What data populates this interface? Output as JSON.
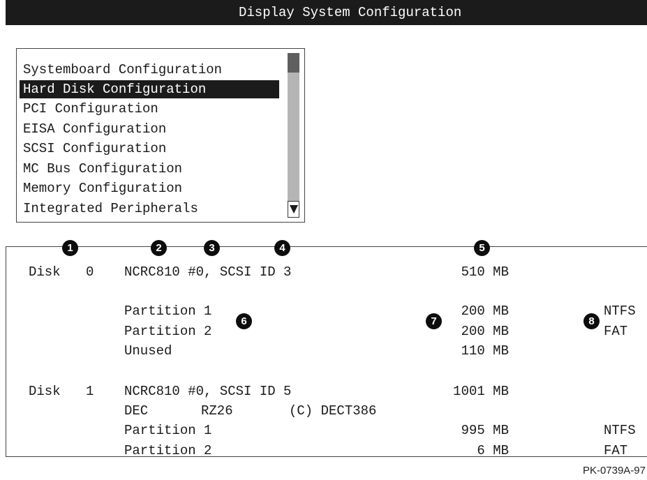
{
  "title": "Display System Configuration",
  "menu": {
    "items": [
      "Systemboard Configuration",
      "Hard Disk Configuration",
      "PCI Configuration",
      "EISA Configuration",
      "SCSI Configuration",
      "MC Bus Configuration",
      "Memory Configuration",
      "Integrated Peripherals"
    ],
    "selected": "Hard Disk Configuration"
  },
  "disks": [
    {
      "label": "Disk",
      "num": "0",
      "controller": "NCRC810 #0, SCSI ID 3",
      "size": "510 MB",
      "partitions": [
        {
          "name": "Partition 1",
          "size": "200 MB",
          "fs": "NTFS"
        },
        {
          "name": "Partition 2",
          "size": "200 MB",
          "fs": "FAT"
        },
        {
          "name": "Unused",
          "size": "110 MB",
          "fs": ""
        }
      ]
    },
    {
      "label": "Disk",
      "num": "1",
      "controller": "NCRC810 #0, SCSI ID 5",
      "size": "1001 MB",
      "vendor": "DEC",
      "model": "RZ26",
      "revision": "(C) DECT386",
      "partitions": [
        {
          "name": "Partition 1",
          "size": "995 MB",
          "fs": "NTFS"
        },
        {
          "name": "Partition 2",
          "size": "6 MB",
          "fs": "FAT"
        }
      ]
    }
  ],
  "callouts": [
    "1",
    "2",
    "3",
    "4",
    "5",
    "6",
    "7",
    "8"
  ],
  "figure_id": "PK-0739A-97",
  "colors": {
    "title_bar": "#1b1b1b",
    "selection": "#1b1b1b",
    "scrollbar": "#b5b5b5",
    "scroll_thumb": "#5f5f5f"
  }
}
